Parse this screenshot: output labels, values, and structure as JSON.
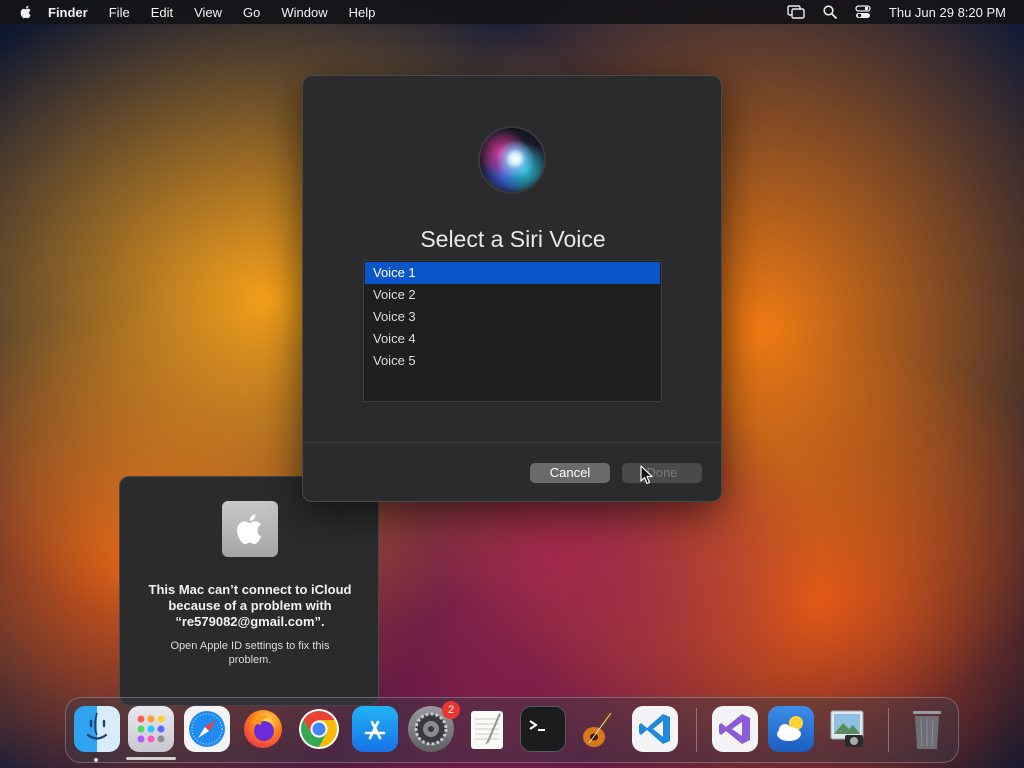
{
  "menubar": {
    "app_name": "Finder",
    "items": [
      "File",
      "Edit",
      "View",
      "Go",
      "Window",
      "Help"
    ],
    "clock": "Thu Jun 29  8:20 PM"
  },
  "siri_dialog": {
    "title": "Select a Siri Voice",
    "voices": [
      "Voice 1",
      "Voice 2",
      "Voice 3",
      "Voice 4",
      "Voice 5"
    ],
    "selected_voice": "Voice 1",
    "cancel_label": "Cancel",
    "done_label": "Done"
  },
  "icloud_notice": {
    "title": "This Mac can’t connect to iCloud because of a problem with “re579082@gmail.com”.",
    "body": "Open Apple ID settings to fix this problem."
  },
  "dock": {
    "settings_badge": "2",
    "apps": [
      "finder-icon",
      "launchpad-icon",
      "safari-icon",
      "firefox-icon",
      "chrome-icon",
      "app-store-icon",
      "system-settings-icon",
      "textedit-icon",
      "terminal-icon",
      "garageband-icon",
      "vscode-icon",
      "visual-studio-icon",
      "weather-icon",
      "preview-icon",
      "trash-icon"
    ]
  },
  "colors": {
    "selection": "#0a56c9",
    "dialog_bg": "#2b2b2d",
    "badge": "#e8352e"
  }
}
